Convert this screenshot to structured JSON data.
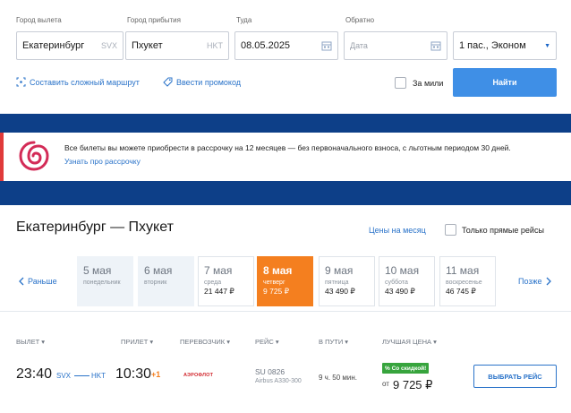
{
  "search": {
    "from_label": "Город вылета",
    "from_value": "Екатеринбург",
    "from_code": "SVX",
    "to_label": "Город прибытия",
    "to_value": "Пхукет",
    "to_code": "HKT",
    "depart_label": "Туда",
    "depart_value": "08.05.2025",
    "return_label": "Обратно",
    "return_placeholder": "Дата",
    "passengers_value": "1 пас., Эконом",
    "complex_route_link": "Составить сложный маршрут",
    "promo_link": "Ввести промокод",
    "miles_label": "За мили",
    "find_button": "Найти"
  },
  "banner": {
    "text": "Все билеты вы можете приобрести в рассрочку на 12 месяцев — без первоначального взноса, с льготным периодом 30 дней.",
    "link": "Узнать про рассрочку",
    "accent_color": "#e03a3a"
  },
  "results": {
    "route_title": "Екатеринбург — Пхукет",
    "month_prices_link": "Цены на месяц",
    "direct_only_label": "Только прямые рейсы",
    "prev_label": "Раньше",
    "next_label": "Позже",
    "days": [
      {
        "date": "5 мая",
        "weekday": "понедельник",
        "price": ""
      },
      {
        "date": "6 мая",
        "weekday": "вторник",
        "price": ""
      },
      {
        "date": "7 мая",
        "weekday": "среда",
        "price": "21 447 ₽"
      },
      {
        "date": "8 мая",
        "weekday": "четверг",
        "price": "9 725 ₽"
      },
      {
        "date": "9 мая",
        "weekday": "пятница",
        "price": "43 490 ₽"
      },
      {
        "date": "10 мая",
        "weekday": "суббота",
        "price": "43 490 ₽"
      },
      {
        "date": "11 мая",
        "weekday": "воскресенье",
        "price": "46 745 ₽"
      }
    ],
    "columns": {
      "departure": "ВЫЛЕТ",
      "arrival": "ПРИЛЕТ",
      "carrier": "ПЕРЕВОЗЧИК",
      "flight": "РЕЙС",
      "duration": "В ПУТИ",
      "best_price": "ЛУЧШАЯ ЦЕНА"
    },
    "flight": {
      "dep_time": "23:40",
      "dep_code": "SVX",
      "arr_code": "HKT",
      "arr_time": "10:30",
      "plus_day": "+1",
      "airline_name": "АЭРОФЛОТ",
      "flight_no": "SU 0826",
      "aircraft": "Airbus A330-300",
      "duration": "9 ч. 50 мин.",
      "discount_badge": "% Со скидкой!",
      "price_prefix": "от",
      "price": "9 725 ₽",
      "select_button": "ВЫБРАТЬ РЕЙС"
    }
  },
  "colors": {
    "brand_blue": "#0d3f88",
    "button_blue": "#3f8fe6",
    "link_blue": "#2a73c9",
    "active_orange": "#f47f1f",
    "discount_green": "#37a43d"
  }
}
